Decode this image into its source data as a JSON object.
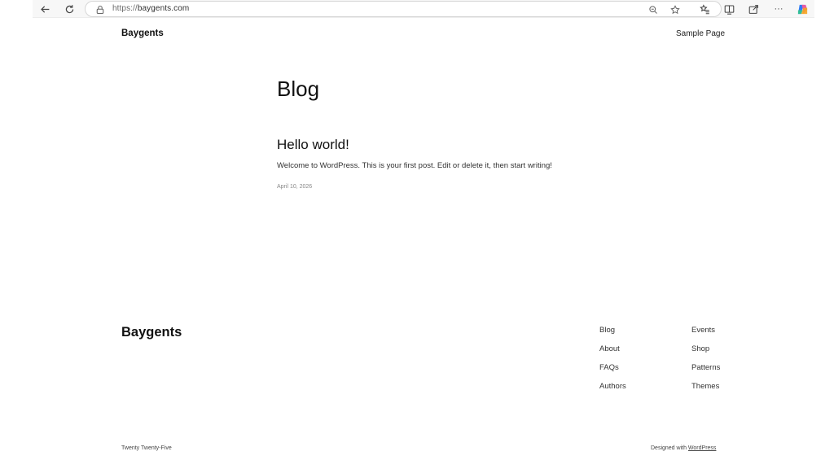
{
  "browser": {
    "url_scheme": "https://",
    "url_host": "baygents.com",
    "more_label": "···"
  },
  "header": {
    "site_title": "Baygents",
    "nav_link": "Sample Page"
  },
  "main": {
    "heading": "Blog",
    "post": {
      "title": "Hello world!",
      "excerpt": "Welcome to WordPress. This is your first post. Edit or delete it, then start writing!",
      "date": "April 10, 2026"
    }
  },
  "footer": {
    "site_title": "Baygents",
    "nav_col1": [
      "Blog",
      "About",
      "FAQs",
      "Authors"
    ],
    "nav_col2": [
      "Events",
      "Shop",
      "Patterns",
      "Themes"
    ],
    "theme_name": "Twenty Twenty-Five",
    "credit_prefix": "Designed with",
    "credit_link": "WordPress"
  },
  "icons": {
    "back": "back-arrow-icon",
    "refresh": "refresh-icon",
    "lock": "site-info-icon",
    "zoom": "zoom-icon",
    "favorite": "star-icon",
    "favorites": "favorites-icon",
    "split": "split-screen-icon",
    "share": "share-icon",
    "more": "more-icon",
    "copilot": "copilot-icon"
  }
}
